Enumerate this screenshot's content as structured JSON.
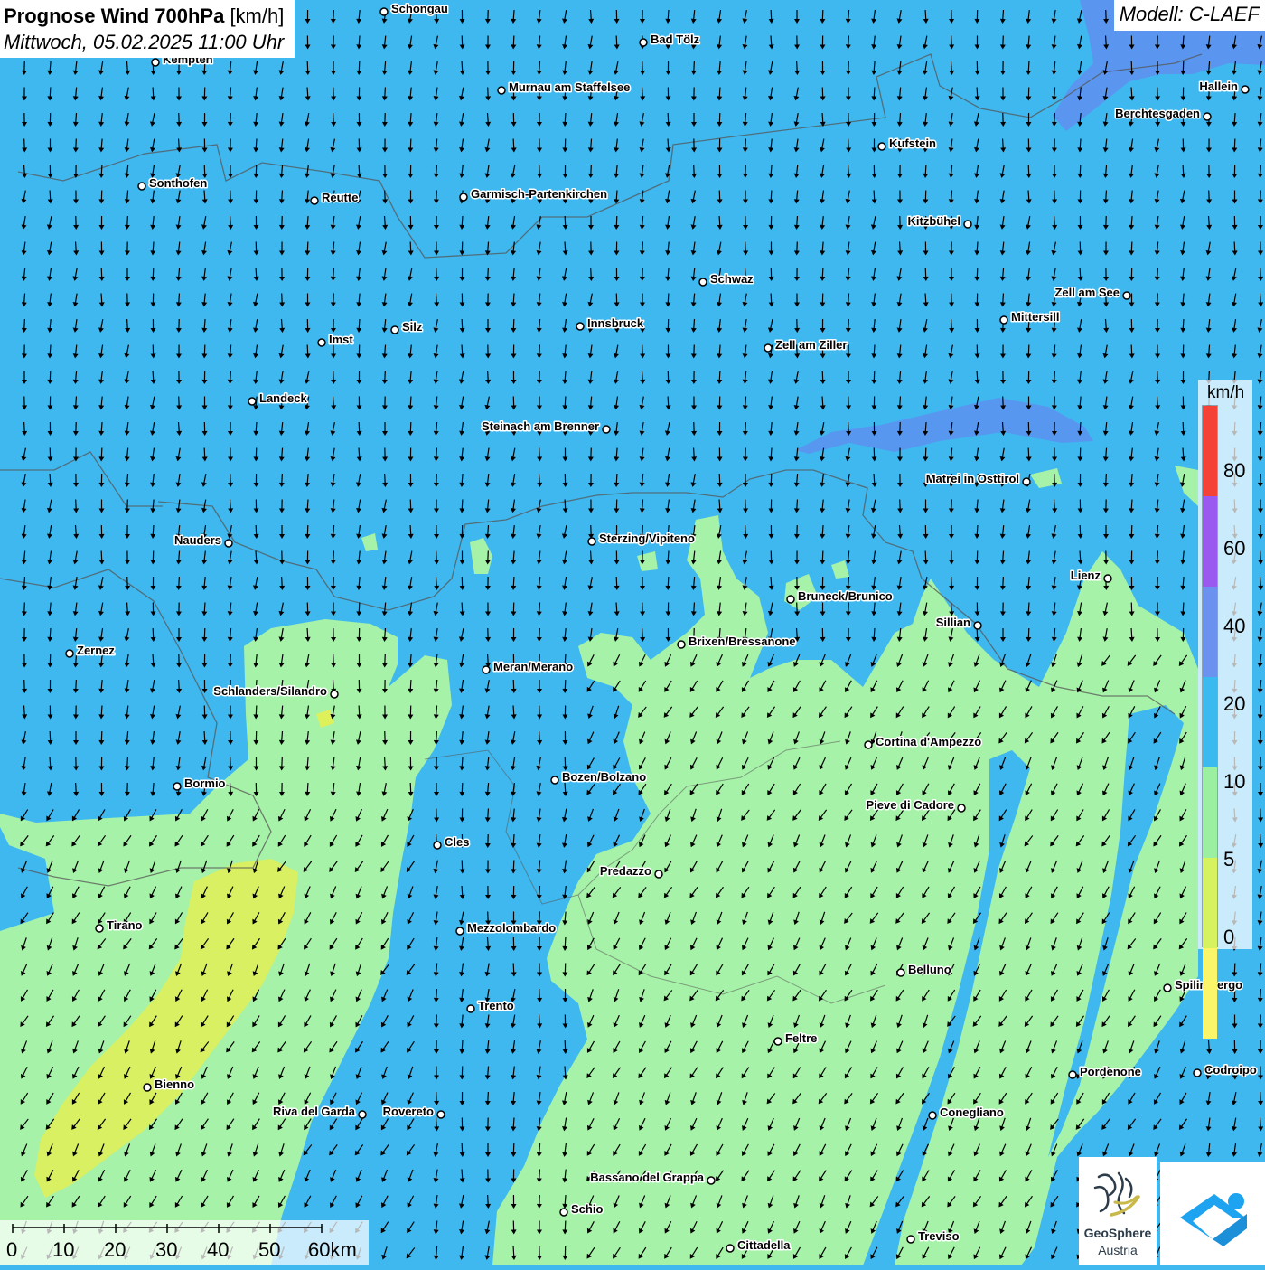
{
  "header": {
    "title": "Prognose Wind 700hPa",
    "unit": "[km/h]",
    "datetime": "Mittwoch, 05.02.2025 11:00 Uhr"
  },
  "model_label": "Modell: C-LAEF",
  "legend": {
    "unit": "km/h",
    "ticks": [
      "80",
      "60",
      "40",
      "20",
      "10",
      "5",
      "0"
    ],
    "colors": [
      "#f44336",
      "#9a5af0",
      "#6a92ee",
      "#3bbaf0",
      "#9af0a0",
      "#d6f25e",
      "#fbf56a"
    ]
  },
  "scalebar": {
    "labels": [
      "0",
      "10",
      "20",
      "30",
      "40",
      "50",
      "60km"
    ]
  },
  "logos": {
    "geosphere_line1": "GeoSphere",
    "geosphere_line2": "Austria"
  },
  "colors": {
    "wind_20_40": "#3fb8f0",
    "wind_10_20": "#a6f2a8",
    "wind_5_10": "#def05a",
    "wind_40_60": "#5f8ff0",
    "arrow": "#000000"
  },
  "wind_field": {
    "dominant_direction": "N",
    "dominant_speed_class": "20-40 km/h"
  },
  "cities": [
    {
      "name": "Schongau"
    },
    {
      "name": "Kempten"
    },
    {
      "name": "Bad Tölz"
    },
    {
      "name": "Murnau am Staffelsee"
    },
    {
      "name": "Hallein"
    },
    {
      "name": "Berchtesgaden"
    },
    {
      "name": "Kufstein"
    },
    {
      "name": "Sonthofen"
    },
    {
      "name": "Reutte"
    },
    {
      "name": "Garmisch-Partenkirchen"
    },
    {
      "name": "Kitzbühel"
    },
    {
      "name": "Schwaz"
    },
    {
      "name": "Zell am See"
    },
    {
      "name": "Mittersill"
    },
    {
      "name": "Innsbruck"
    },
    {
      "name": "Silz"
    },
    {
      "name": "Imst"
    },
    {
      "name": "Zell am Ziller"
    },
    {
      "name": "Landeck"
    },
    {
      "name": "Steinach am Brenner"
    },
    {
      "name": "Matrei in Osttirol"
    },
    {
      "name": "Nauders"
    },
    {
      "name": "Sterzing/Vipiteno"
    },
    {
      "name": "Lienz"
    },
    {
      "name": "Bruneck/Brunico"
    },
    {
      "name": "Sillian"
    },
    {
      "name": "Brixen/Bressanone"
    },
    {
      "name": "Zernez"
    },
    {
      "name": "Meran/Merano"
    },
    {
      "name": "Schlanders/Silandro"
    },
    {
      "name": "Cortina d'Ampezzo"
    },
    {
      "name": "Bormio"
    },
    {
      "name": "Bozen/Bolzano"
    },
    {
      "name": "Pieve di Cadore"
    },
    {
      "name": "Cles"
    },
    {
      "name": "Predazzo"
    },
    {
      "name": "Tirano"
    },
    {
      "name": "Mezzolombardo"
    },
    {
      "name": "Belluno"
    },
    {
      "name": "Spilimbergo"
    },
    {
      "name": "Trento"
    },
    {
      "name": "Feltre"
    },
    {
      "name": "Bienno"
    },
    {
      "name": "Pordenone"
    },
    {
      "name": "Codroipo"
    },
    {
      "name": "Riva del Garda"
    },
    {
      "name": "Rovereto"
    },
    {
      "name": "Conegliano"
    },
    {
      "name": "Bassano del Grappa"
    },
    {
      "name": "Schio"
    },
    {
      "name": "Treviso"
    },
    {
      "name": "Cittadella"
    }
  ]
}
